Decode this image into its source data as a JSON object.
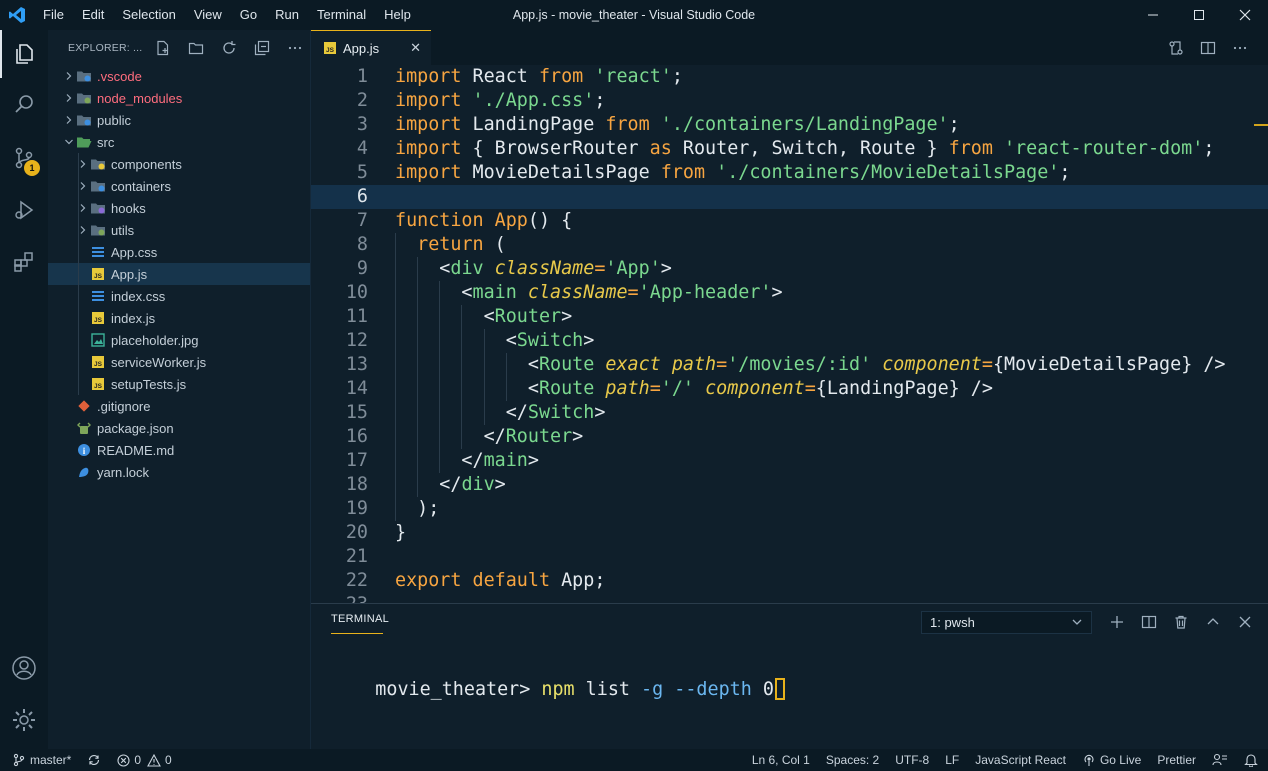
{
  "window": {
    "title": "App.js - movie_theater - Visual Studio Code",
    "menu": [
      "File",
      "Edit",
      "Selection",
      "View",
      "Go",
      "Run",
      "Terminal",
      "Help"
    ]
  },
  "activity": {
    "scm_badge": "1"
  },
  "explorer": {
    "header": "EXPLORER: ...",
    "tree": [
      {
        "label": ".vscode",
        "type": "folder",
        "depth": 0,
        "color": "#ff6d7e"
      },
      {
        "label": "node_modules",
        "type": "folder",
        "depth": 0,
        "color": "#ff6d7e"
      },
      {
        "label": "public",
        "type": "folder",
        "depth": 0,
        "color": "#c4cfd8"
      },
      {
        "label": "src",
        "type": "folder-open",
        "depth": 0,
        "color": "#c4cfd8"
      },
      {
        "label": "components",
        "type": "folder",
        "depth": 1,
        "color": "#c4cfd8"
      },
      {
        "label": "containers",
        "type": "folder",
        "depth": 1,
        "color": "#c4cfd8"
      },
      {
        "label": "hooks",
        "type": "folder",
        "depth": 1,
        "color": "#c4cfd8"
      },
      {
        "label": "utils",
        "type": "folder",
        "depth": 1,
        "color": "#c4cfd8"
      },
      {
        "label": "App.css",
        "type": "css",
        "depth": 1,
        "color": "#c4cfd8"
      },
      {
        "label": "App.js",
        "type": "js",
        "depth": 1,
        "color": "#c4cfd8",
        "selected": true
      },
      {
        "label": "index.css",
        "type": "css",
        "depth": 1,
        "color": "#c4cfd8"
      },
      {
        "label": "index.js",
        "type": "js",
        "depth": 1,
        "color": "#c4cfd8"
      },
      {
        "label": "placeholder.jpg",
        "type": "img",
        "depth": 1,
        "color": "#c4cfd8"
      },
      {
        "label": "serviceWorker.js",
        "type": "js",
        "depth": 1,
        "color": "#c4cfd8"
      },
      {
        "label": "setupTests.js",
        "type": "js",
        "depth": 1,
        "color": "#c4cfd8"
      },
      {
        "label": ".gitignore",
        "type": "git",
        "depth": 0,
        "color": "#c4cfd8"
      },
      {
        "label": "package.json",
        "type": "json",
        "depth": 0,
        "color": "#c4cfd8"
      },
      {
        "label": "README.md",
        "type": "info",
        "depth": 0,
        "color": "#c4cfd8"
      },
      {
        "label": "yarn.lock",
        "type": "yarn",
        "depth": 0,
        "color": "#c4cfd8"
      }
    ]
  },
  "tabs": [
    {
      "label": "App.js",
      "active": true
    }
  ],
  "editor": {
    "current_line": 6,
    "lines": [
      [
        [
          "kw",
          "import"
        ],
        [
          "id",
          " React "
        ],
        [
          "kw",
          "from"
        ],
        [
          "id",
          " "
        ],
        [
          "str",
          "'react'"
        ],
        [
          "id",
          ";"
        ]
      ],
      [
        [
          "kw",
          "import"
        ],
        [
          "id",
          " "
        ],
        [
          "str",
          "'./App.css'"
        ],
        [
          "id",
          ";"
        ]
      ],
      [
        [
          "kw",
          "import"
        ],
        [
          "id",
          " LandingPage "
        ],
        [
          "kw",
          "from"
        ],
        [
          "id",
          " "
        ],
        [
          "str",
          "'./containers/LandingPage'"
        ],
        [
          "id",
          ";"
        ]
      ],
      [
        [
          "kw",
          "import"
        ],
        [
          "id",
          " { BrowserRouter "
        ],
        [
          "kw",
          "as"
        ],
        [
          "id",
          " Router, Switch, Route } "
        ],
        [
          "kw",
          "from"
        ],
        [
          "id",
          " "
        ],
        [
          "str",
          "'react-router-dom'"
        ],
        [
          "id",
          ";"
        ]
      ],
      [
        [
          "kw",
          "import"
        ],
        [
          "id",
          " MovieDetailsPage "
        ],
        [
          "kw",
          "from"
        ],
        [
          "id",
          " "
        ],
        [
          "str",
          "'./containers/MovieDetailsPage'"
        ],
        [
          "id",
          ";"
        ]
      ],
      [],
      [
        [
          "kw",
          "function"
        ],
        [
          "id",
          " "
        ],
        [
          "fn",
          "App"
        ],
        [
          "id",
          "() {"
        ]
      ],
      [
        [
          "id",
          "  "
        ],
        [
          "kw",
          "return"
        ],
        [
          "id",
          " ("
        ]
      ],
      [
        [
          "id",
          "    <"
        ],
        [
          "jsx",
          "div"
        ],
        [
          "id",
          " "
        ],
        [
          "attr",
          "className"
        ],
        [
          "kw",
          "="
        ],
        [
          "str",
          "'App'"
        ],
        [
          "id",
          ">"
        ]
      ],
      [
        [
          "id",
          "      <"
        ],
        [
          "jsx",
          "main"
        ],
        [
          "id",
          " "
        ],
        [
          "attr",
          "className"
        ],
        [
          "kw",
          "="
        ],
        [
          "str",
          "'App-header'"
        ],
        [
          "id",
          ">"
        ]
      ],
      [
        [
          "id",
          "        <"
        ],
        [
          "jsx",
          "Router"
        ],
        [
          "id",
          ">"
        ]
      ],
      [
        [
          "id",
          "          <"
        ],
        [
          "jsx",
          "Switch"
        ],
        [
          "id",
          ">"
        ]
      ],
      [
        [
          "id",
          "            <"
        ],
        [
          "jsx",
          "Route"
        ],
        [
          "id",
          " "
        ],
        [
          "attr",
          "exact"
        ],
        [
          "id",
          " "
        ],
        [
          "attr",
          "path"
        ],
        [
          "kw",
          "="
        ],
        [
          "str",
          "'/movies/:id'"
        ],
        [
          "id",
          " "
        ],
        [
          "attr",
          "component"
        ],
        [
          "kw",
          "="
        ],
        [
          "id",
          "{MovieDetailsPage} />"
        ]
      ],
      [
        [
          "id",
          "            <"
        ],
        [
          "jsx",
          "Route"
        ],
        [
          "id",
          " "
        ],
        [
          "attr",
          "path"
        ],
        [
          "kw",
          "="
        ],
        [
          "str",
          "'/'"
        ],
        [
          "id",
          " "
        ],
        [
          "attr",
          "component"
        ],
        [
          "kw",
          "="
        ],
        [
          "id",
          "{LandingPage} />"
        ]
      ],
      [
        [
          "id",
          "          </"
        ],
        [
          "jsx",
          "Switch"
        ],
        [
          "id",
          ">"
        ]
      ],
      [
        [
          "id",
          "        </"
        ],
        [
          "jsx",
          "Router"
        ],
        [
          "id",
          ">"
        ]
      ],
      [
        [
          "id",
          "      </"
        ],
        [
          "jsx",
          "main"
        ],
        [
          "id",
          ">"
        ]
      ],
      [
        [
          "id",
          "    </"
        ],
        [
          "jsx",
          "div"
        ],
        [
          "id",
          ">"
        ]
      ],
      [
        [
          "id",
          "  );"
        ]
      ],
      [
        [
          "id",
          "}"
        ]
      ],
      [],
      [
        [
          "kw",
          "export"
        ],
        [
          "id",
          " "
        ],
        [
          "kw",
          "default"
        ],
        [
          "id",
          " App;"
        ]
      ],
      []
    ]
  },
  "panel": {
    "tab_label": "TERMINAL",
    "terminal_select": "1: pwsh",
    "prompt": "movie_theater> ",
    "cmd": "npm",
    "arg": " list ",
    "flag1": "-g",
    "sp": " ",
    "flag2": "--depth",
    "num": " 0"
  },
  "status": {
    "branch": "master*",
    "errors": "0",
    "warnings": "0",
    "position": "Ln 6, Col 1",
    "spaces": "Spaces: 2",
    "encoding": "UTF-8",
    "eol": "LF",
    "language": "JavaScript React",
    "golive": "Go Live",
    "prettier": "Prettier"
  }
}
